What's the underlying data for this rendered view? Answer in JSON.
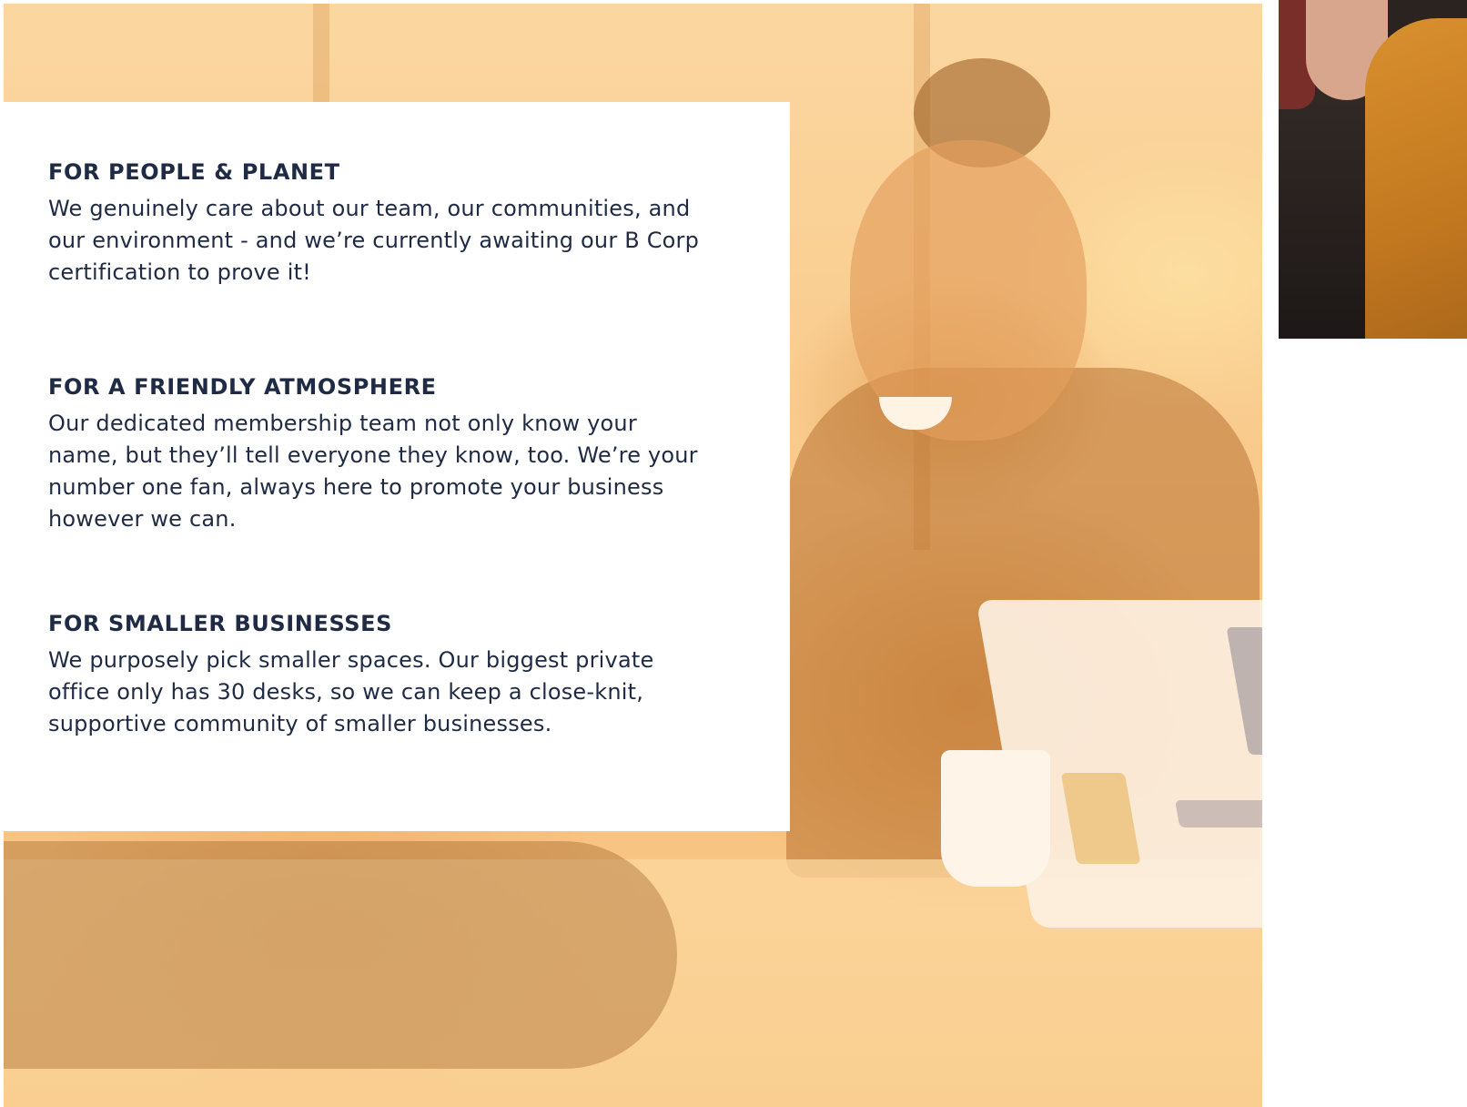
{
  "features": [
    {
      "heading": "FOR PEOPLE & PLANET",
      "body": "We genuinely care about our team, our communities, and our environment - and we’re currently awaiting our B Corp certification to prove it!"
    },
    {
      "heading": "FOR A FRIENDLY ATMOSPHERE",
      "body": "Our dedicated membership team not only know your name, but they’ll tell everyone they know, too. We’re your number one fan, always here to promote your business however we can."
    },
    {
      "heading": "FOR SMALLER BUSINESSES",
      "body": "We purposely pick smaller spaces. Our biggest private office only has 30 desks, so we can keep a close-knit, supportive community of smaller businesses."
    }
  ],
  "colors": {
    "text": "#1f2a44",
    "hero_tint": "#f9c98a",
    "card": "#ffffff"
  }
}
